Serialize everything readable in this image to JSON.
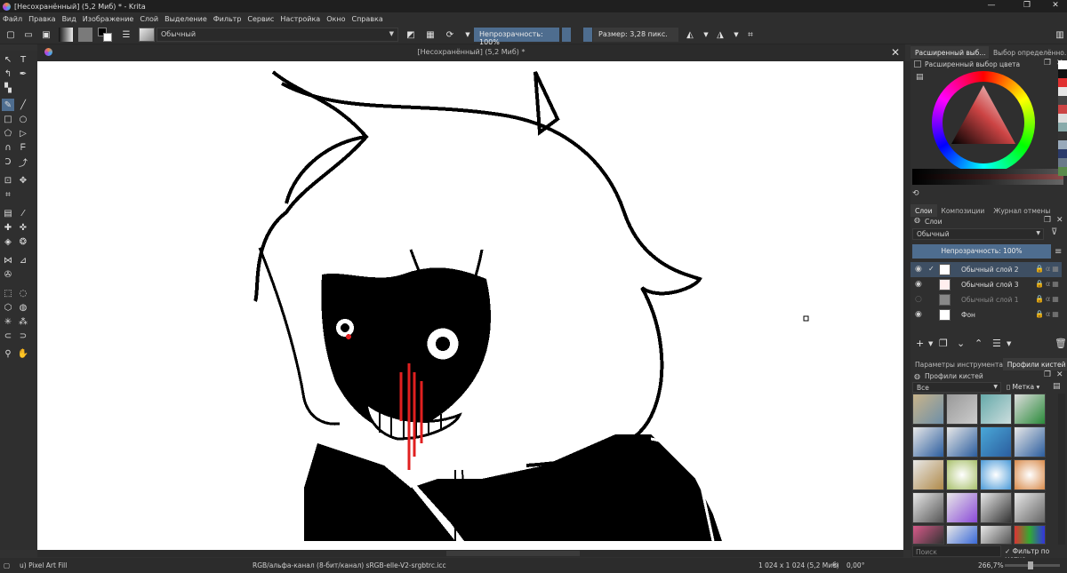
{
  "window": {
    "title": "[Несохранённый]  (5,2 Миб) * - Krita",
    "minimize": "—",
    "maximize": "❐",
    "close": "✕"
  },
  "menu": [
    "Файл",
    "Правка",
    "Вид",
    "Изображение",
    "Слой",
    "Выделение",
    "Фильтр",
    "Сервис",
    "Настройка",
    "Окно",
    "Справка"
  ],
  "toolbar": {
    "blend_mode": "Обычный",
    "opacity": "Непрозрачность: 100%",
    "size": "Размер: 3,28 пикс."
  },
  "document": {
    "tab_title": "[Несохранённый]  (5,2 Миб) *",
    "close": "✕"
  },
  "dock": {
    "color_tabs": [
      "Расширенный выб...",
      "Выбор определённо..."
    ],
    "color_header": "Расширенный выбор цвета",
    "layer_tabs": [
      "Слои",
      "Композиции",
      "Журнал отмены"
    ],
    "layers_header": "Слои",
    "layers_blend": "Обычный",
    "layers_opacity": "Непрозрачность: 100%",
    "layers": [
      {
        "name": "Обычный слой 2",
        "selected": true,
        "visible": true
      },
      {
        "name": "Обычный слой 3",
        "selected": false,
        "visible": true
      },
      {
        "name": "Обычный слой 1",
        "selected": false,
        "visible": false
      },
      {
        "name": "Фон",
        "selected": false,
        "visible": true
      }
    ],
    "brush_tabs": [
      "Параметры инструмента",
      "Профили кистей"
    ],
    "brush_header": "Профили кистей",
    "brush_filter": "Все",
    "brush_tag": "Метка",
    "search_placeholder": "Поиск",
    "tag_filter": "Фильтр по метке"
  },
  "status": {
    "tool": "u) Pixel Art Fill",
    "color_space": "RGB/альфа-канал (8-бит/канал)  sRGB-elle-V2-srgbtrc.icc",
    "dimensions": "1 024 x 1 024 (5,2 Миб)",
    "rotation": "0,00°",
    "zoom": "266,7%"
  },
  "colors": {
    "accent": "#4e6d8f",
    "canvas": "#ffffff",
    "ink": "#000000",
    "blood": "#e02020"
  }
}
